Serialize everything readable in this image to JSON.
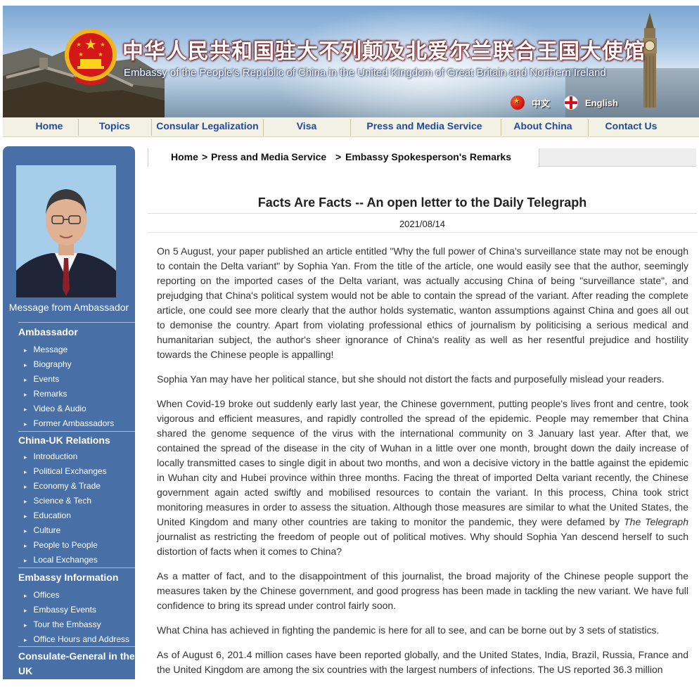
{
  "header": {
    "title_cn": "中华人民共和国驻大不列颠及北爱尔兰联合王国大使馆",
    "title_en": "Embassy of the People's Republic of China in the United Kingdom of Great Britain and Northern Ireland",
    "lang_cn": "中文",
    "lang_en": "English"
  },
  "nav": {
    "items": [
      "Home",
      "Topics",
      "Consular Legalization",
      "Visa",
      "Press and Media Service",
      "About China",
      "Contact Us"
    ]
  },
  "sidebar": {
    "message_label": "Message from Ambassador",
    "sections": [
      {
        "title": "Ambassador",
        "items": [
          "Message",
          "Biography",
          "Events",
          "Remarks",
          "Video & Audio",
          "Former Ambassadors"
        ]
      },
      {
        "title": "China-UK Relations",
        "items": [
          "Introduction",
          "Political Exchanges",
          "Economy & Trade",
          "Science & Tech",
          "Education",
          "Culture",
          "People to People",
          "Local Exchanges"
        ]
      },
      {
        "title": "Embassy Information",
        "items": [
          "Offices",
          "Embassy Events",
          "Tour the Embassy",
          "Office Hours and Address"
        ]
      },
      {
        "title": "Consulate-General in the UK",
        "items": []
      }
    ]
  },
  "breadcrumb": {
    "home": "Home",
    "sep": ">",
    "section": "Press and Media Service",
    "page": "Embassy Spokesperson's Remarks"
  },
  "article": {
    "title": "Facts Are Facts -- An open letter to the Daily Telegraph",
    "date": "2021/08/14",
    "paragraphs": [
      "On 5 August, your paper published an article entitled \"Why the full power of China's surveillance state may not be enough to contain the Delta variant\" by Sophia Yan. From the title of the article, one would easily see that the author, seemingly reporting on the imported cases of the Delta variant, was actually accusing China of being \"surveillance state\", and prejudging that China's political system would not be able to contain the spread of the variant. After reading the complete article, one could see more clearly that the author holds systematic, wanton assumptions against China and goes all out to demonise the country. Apart from violating professional ethics of journalism by politicising a serious medical and humanitarian subject, the author's sheer ignorance of China's reality as well as her resentful prejudice and hostility towards the Chinese people is appalling!",
      "Sophia Yan may have her political stance, but she should not distort the facts and purposefully mislead your readers.",
      "When Covid-19 broke out suddenly early last year, the Chinese government, putting people's lives front and centre, took vigorous and efficient measures, and rapidly controlled the spread of the epidemic. People may remember that China shared the genome sequence of the virus with the international community on 3 January last year. After that, we contained the spread of the disease in the city of Wuhan in a little over one month, brought down the daily increase of locally transmitted cases to single digit in about two months, and won a decisive victory in the battle against the epidemic in Wuhan city and Hubei province within three months. Facing the threat of imported Delta variant recently, the Chinese government again acted swiftly and mobilised resources to contain the variant. In this process, China took strict monitoring measures in order to assess the situation. Although those measures are similar to what the United States, the United Kingdom and many other countries are taking to monitor the pandemic, they were defamed by",
      "The Telegraph",
      "journalist as restricting the freedom of people out of political motives. Why should Sophia Yan descend herself to such distortion of facts when it comes to China?",
      "As a matter of fact, and to the disappointment of this journalist, the broad majority of the Chinese people support the measures taken by the Chinese government, and good progress has been made in tackling the new variant. We have full confidence to bring its spread under control fairly soon.",
      "What China has achieved in fighting the pandemic is here for all to see, and can be borne out by 3 sets of statistics.",
      "As of August 6, 201.4 million cases have been reported globally, and the United States, India, Brazil, Russia, France and the United Kingdom are among the six countries with the largest numbers of infections. The US reported 36.3 million"
    ]
  }
}
